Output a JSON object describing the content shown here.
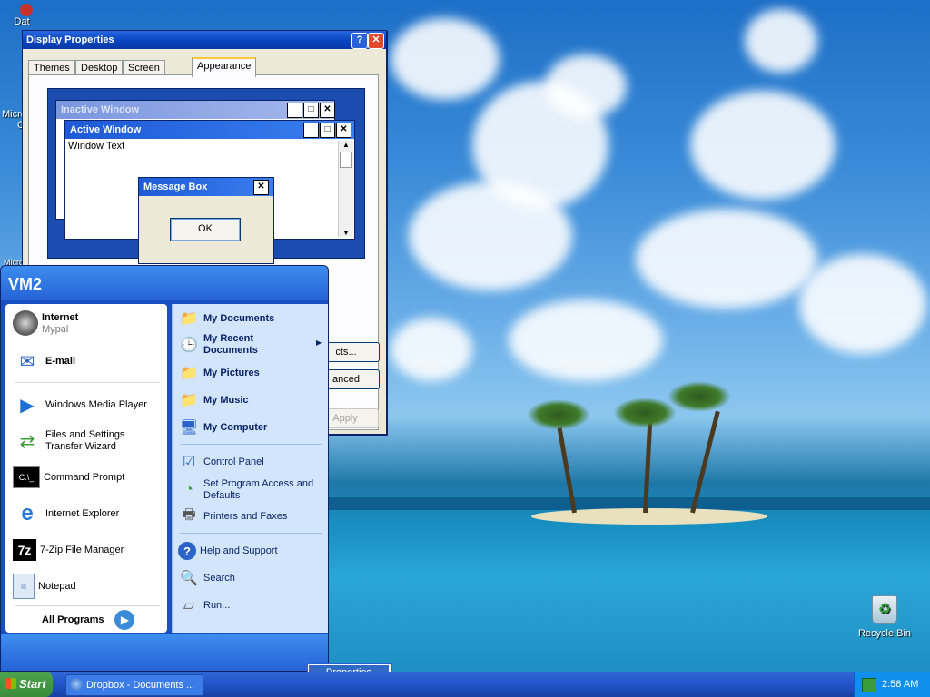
{
  "desktop": {
    "icons": [
      {
        "label": "Dat"
      },
      {
        "label": "Micro"
      },
      {
        "label": "C"
      },
      {
        "label": "Micro"
      }
    ],
    "recycle_bin": {
      "label": "Recycle Bin"
    }
  },
  "display_properties": {
    "title": "Display Properties",
    "help_btn": "?",
    "close_btn": "✕",
    "tabs": [
      "Themes",
      "Desktop",
      "Screen Saver",
      "Appearance"
    ],
    "active_tab": "Appearance",
    "preview": {
      "inactive_title": "Inactive Window",
      "active_title": "Active Window",
      "window_text": "Window Text",
      "message_box_title": "Message Box",
      "ok": "OK"
    },
    "effects_btn": "cts...",
    "advanced_btn": "anced",
    "apply_btn": "Apply"
  },
  "start_menu": {
    "user": "VM2",
    "pinned": [
      {
        "label": "Internet",
        "sub": "Mypal",
        "icon": "raccoon-icon"
      },
      {
        "label": "E-mail",
        "icon": "mail-icon"
      }
    ],
    "recent": [
      {
        "label": "Windows Media Player",
        "icon": "media-player-icon"
      },
      {
        "label": "Files and Settings Transfer Wizard",
        "icon": "transfer-wizard-icon"
      },
      {
        "label": "Command Prompt",
        "icon": "command-prompt-icon"
      },
      {
        "label": "Internet Explorer",
        "icon": "internet-explorer-icon"
      },
      {
        "label": "7-Zip File Manager",
        "icon": "7zip-icon"
      },
      {
        "label": "Notepad",
        "icon": "notepad-icon"
      }
    ],
    "all_programs": "All Programs",
    "places": [
      {
        "label": "My Documents",
        "icon": "documents-folder-icon"
      },
      {
        "label": "My Recent Documents",
        "icon": "recent-documents-icon"
      },
      {
        "label": "My Pictures",
        "icon": "pictures-folder-icon"
      },
      {
        "label": "My Music",
        "icon": "music-folder-icon"
      },
      {
        "label": "My Computer",
        "icon": "computer-icon"
      }
    ],
    "system": [
      {
        "label": "Control Panel",
        "icon": "control-panel-icon"
      },
      {
        "label": "Set Program Access and Defaults",
        "icon": "program-access-icon"
      },
      {
        "label": "Printers and Faxes",
        "icon": "printer-icon"
      }
    ],
    "help": [
      {
        "label": "Help and Support",
        "icon": "help-icon"
      },
      {
        "label": "Search",
        "icon": "search-icon"
      },
      {
        "label": "Run...",
        "icon": "run-icon"
      }
    ]
  },
  "context_menu": {
    "properties": "Properties"
  },
  "taskbar": {
    "start": "Start",
    "task_dropbox": "Dropbox - Documents ...",
    "clock": "2:58 AM"
  },
  "colors": {
    "xp_blue": "#0a47c2",
    "start_green": "#3a8c3a",
    "taskbar_blue": "#2458cf",
    "tray_blue": "#0f90ef"
  }
}
